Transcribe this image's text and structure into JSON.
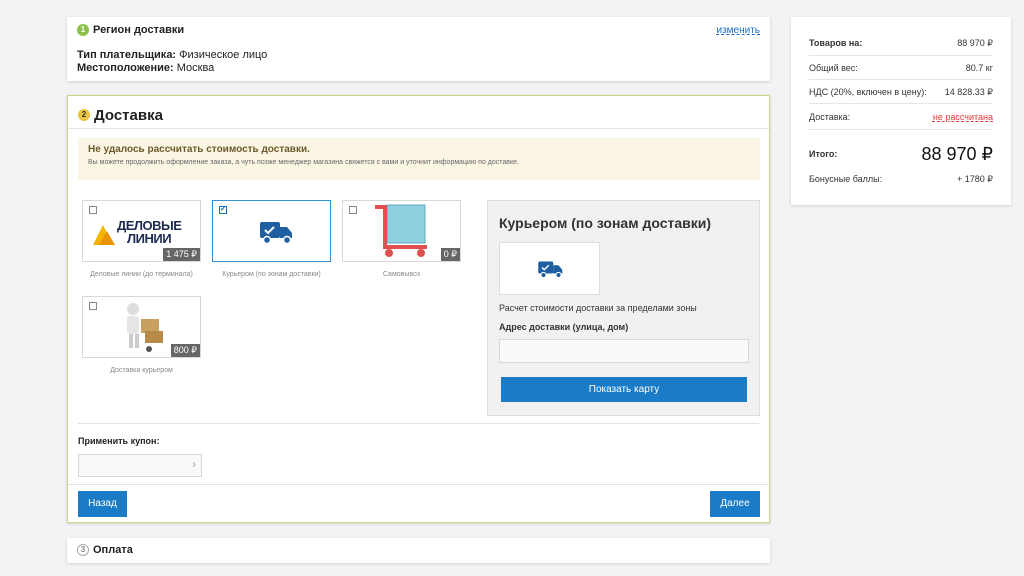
{
  "region": {
    "step": "1",
    "title": "Регион доставки",
    "change_link": "изменить",
    "payer_label": "Тип плательщика:",
    "payer_value": "Физическое лицо",
    "location_label": "Местоположение:",
    "location_value": "Москва"
  },
  "delivery": {
    "step": "2",
    "title": "Доставка",
    "alert_title": "Не удалось рассчитать стоимость доставки.",
    "alert_text": "Вы можете продолжить оформление заказа, а чуть позже менеджер магазина свяжется с вами и уточнит информацию по доставке.",
    "options": [
      {
        "label": "Деловые линии (до терминала)",
        "price": "1 475 ₽",
        "checked": false,
        "logo_text_1": "ДЕЛОВЫЕ",
        "logo_text_2": "ЛИНИИ"
      },
      {
        "label": "Курьером (по зонам доставки)",
        "price": "",
        "checked": true
      },
      {
        "label": "Самовывоз",
        "price": "0 ₽",
        "checked": false
      },
      {
        "label": "Доставка курьером",
        "price": "800 ₽",
        "checked": false
      }
    ],
    "courier": {
      "title": "Курьером (по зонам доставки)",
      "description": "Расчет стоимости доставки за пределами зоны",
      "address_label": "Адрес доставки (улица, дом)",
      "address_value": "",
      "map_button": "Показать карту"
    },
    "coupon_label": "Применить купон:",
    "coupon_value": "",
    "back_button": "Назад",
    "next_button": "Далее"
  },
  "payment": {
    "step": "3",
    "title": "Оплата"
  },
  "summary": {
    "goods_label": "Товаров на:",
    "goods_value": "88 970 ₽",
    "weight_label": "Общий вес:",
    "weight_value": "80.7 кг",
    "vat_label": "НДС (20%, включен в цену):",
    "vat_value": "14 828.33 ₽",
    "delivery_label": "Доставка:",
    "delivery_value": "не рассчитана",
    "total_label": "Итого:",
    "total_value": "88 970 ₽",
    "bonus_label": "Бонусные баллы:",
    "bonus_value": "+ 1780 ₽"
  },
  "colors": {
    "accent": "#1a7cc7",
    "step_done": "#8bc34a",
    "step_active": "#e8c340",
    "warning": "#e03a3a",
    "alert_bg": "#fbf6e4"
  }
}
